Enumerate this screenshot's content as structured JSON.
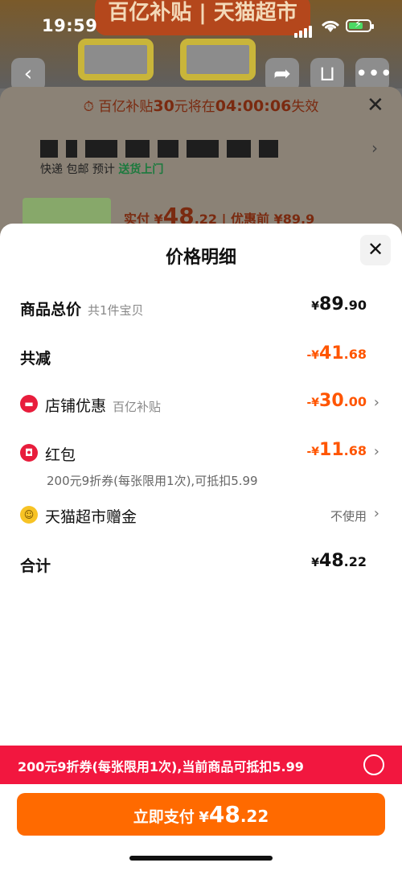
{
  "status_bar": {
    "time": "19:59"
  },
  "background_page": {
    "banner_text": "百亿补贴 | 天猫超市",
    "countdown": {
      "prefix": "百亿补贴",
      "amount": "30",
      "middle": "元将在",
      "time": "04:00:06",
      "suffix": "失效"
    },
    "shipping_info": "快递 包邮   预计",
    "shipping_tag": "送货上门",
    "price_label": "实付",
    "price_currency": "¥",
    "price_int": "48",
    "price_dec": ".22",
    "original_price": "优惠前 ¥89.9"
  },
  "sheet": {
    "title": "价格明细",
    "total": {
      "label": "商品总价",
      "hint": "共1件宝贝",
      "currency": "¥",
      "int": "89",
      "dec": ".90"
    },
    "reduction": {
      "label": "共减",
      "currency": "-¥",
      "int": "41",
      "dec": ".68"
    },
    "store_discount": {
      "label": "店铺优惠",
      "hint": "百亿补贴",
      "currency": "-¥",
      "int": "30",
      "dec": ".00"
    },
    "red_packet": {
      "label": "红包",
      "currency": "-¥",
      "int": "11",
      "dec": ".68",
      "note": "200元9折券(每张限用1次),可抵扣5.99"
    },
    "supermarket_bonus": {
      "label": "天猫超市赠金",
      "value": "不使用"
    },
    "sum": {
      "label": "合计",
      "currency": "¥",
      "int": "48",
      "dec": ".22"
    }
  },
  "coupon_bar": {
    "text": "200元9折券(每张限用1次),当前商品可抵扣5.99"
  },
  "pay_button": {
    "label": "立即支付",
    "currency": "¥",
    "int": "48",
    "dec": ".22"
  },
  "colors": {
    "accent_orange": "#ff5500",
    "coupon_red": "#f2173f",
    "pay_orange": "#ff6a00"
  }
}
